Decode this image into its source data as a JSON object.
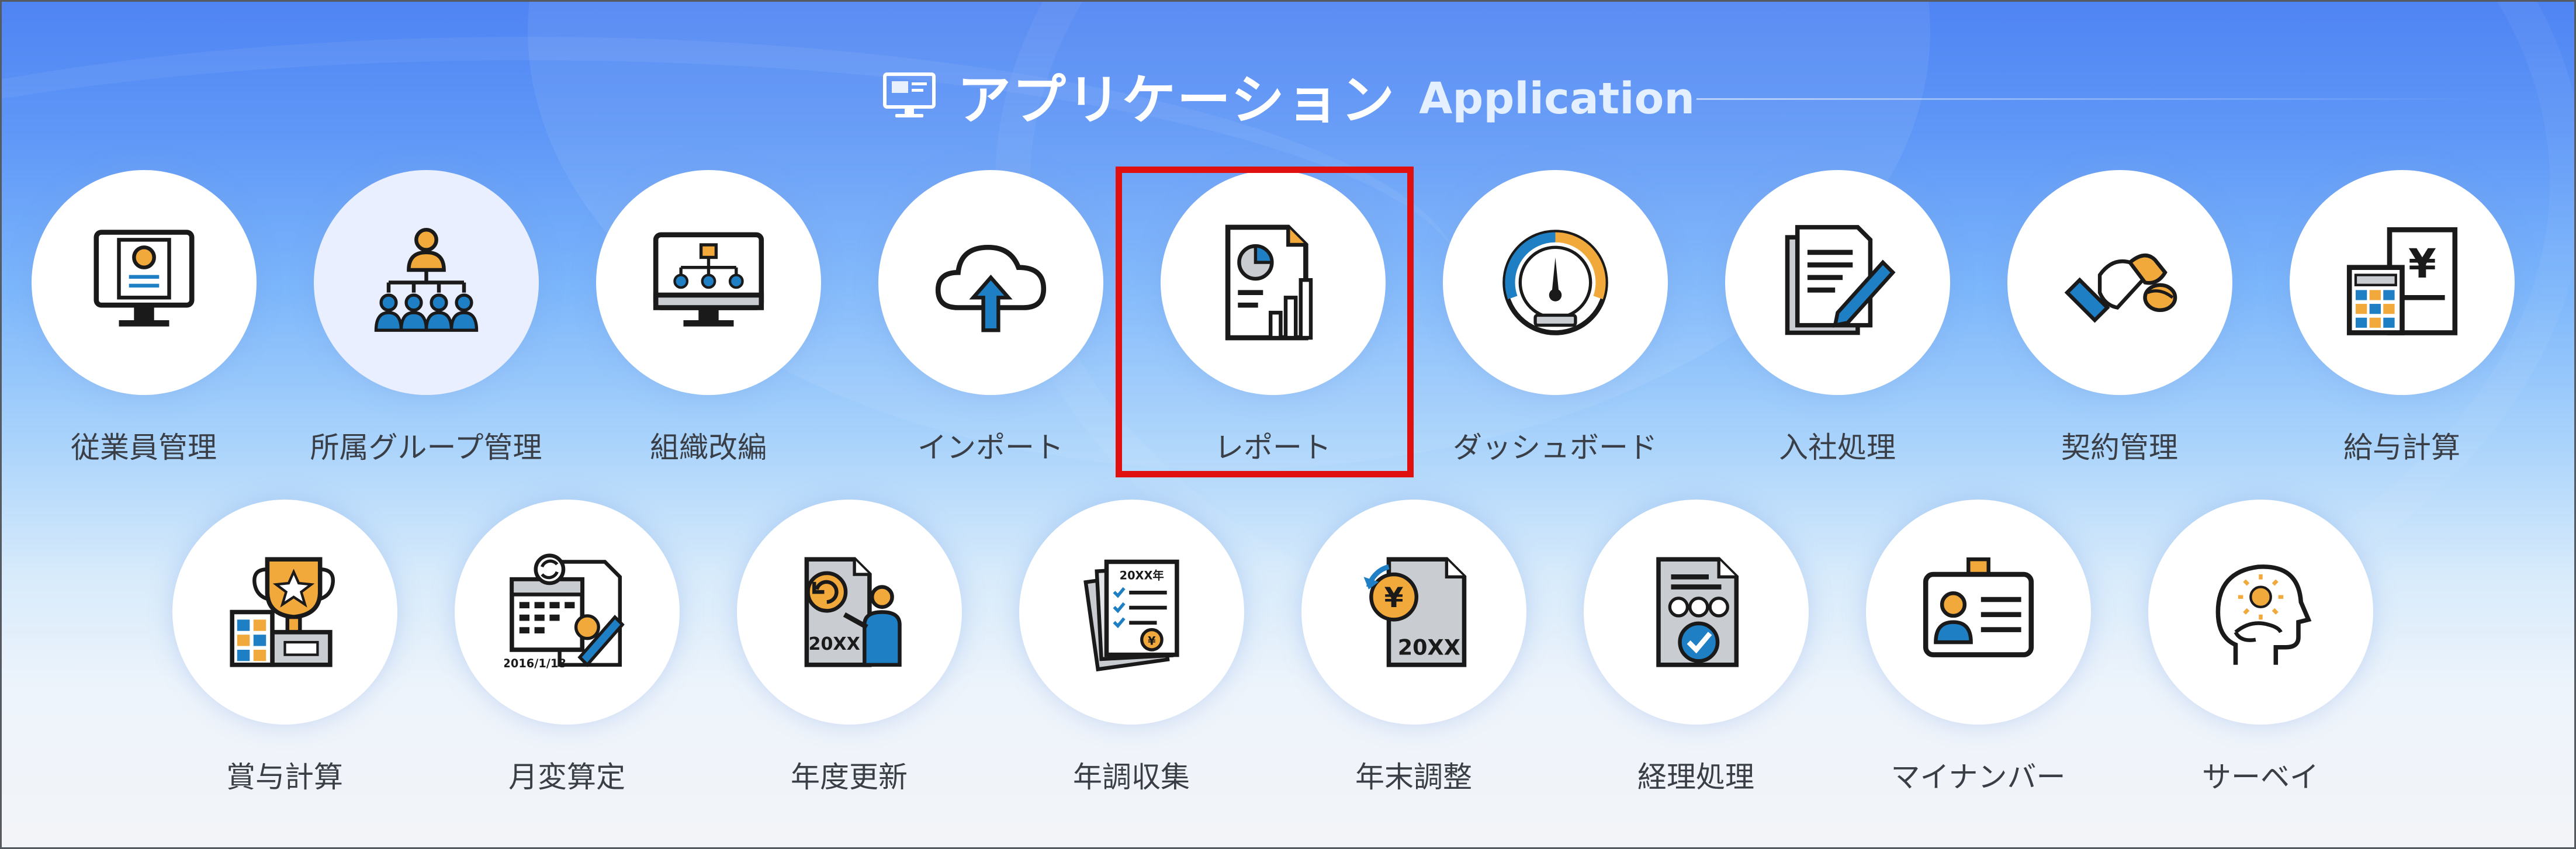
{
  "header": {
    "title_jp": "アプリケーション",
    "title_en": "Application",
    "icon": "monitor-icon"
  },
  "colors": {
    "background_top": "#4f84f3",
    "background_bottom": "#f2f4f8",
    "icon_stroke": "#1a1a1a",
    "icon_orange": "#f2a93b",
    "icon_blue": "#1f7fc4",
    "icon_gray": "#c9ccd1",
    "selection_border": "#e01010"
  },
  "apps": [
    {
      "label": "従業員管理",
      "icon": "employee-monitor-icon"
    },
    {
      "label": "所属グループ管理",
      "icon": "org-group-icon"
    },
    {
      "label": "組織改編",
      "icon": "org-chart-monitor-icon"
    },
    {
      "label": "インポート",
      "icon": "cloud-upload-icon"
    },
    {
      "label": "レポート",
      "icon": "report-chart-icon"
    },
    {
      "label": "ダッシュボード",
      "icon": "gauge-icon"
    },
    {
      "label": "入社処理",
      "icon": "document-pen-icon"
    },
    {
      "label": "契約管理",
      "icon": "handshake-icon"
    },
    {
      "label": "給与計算",
      "icon": "calculator-yen-icon"
    },
    {
      "label": "賞与計算",
      "icon": "trophy-icon"
    },
    {
      "label": "月変算定",
      "icon": "calendar-pen-icon"
    },
    {
      "label": "年度更新",
      "icon": "year-update-icon"
    },
    {
      "label": "年調収集",
      "icon": "year-adjust-docs-icon"
    },
    {
      "label": "年末調整",
      "icon": "yen-document-icon"
    },
    {
      "label": "経理処理",
      "icon": "accounting-doc-icon"
    },
    {
      "label": "マイナンバー",
      "icon": "id-card-icon"
    },
    {
      "label": "サーベイ",
      "icon": "head-sun-icon"
    }
  ],
  "selected_app": "レポート"
}
